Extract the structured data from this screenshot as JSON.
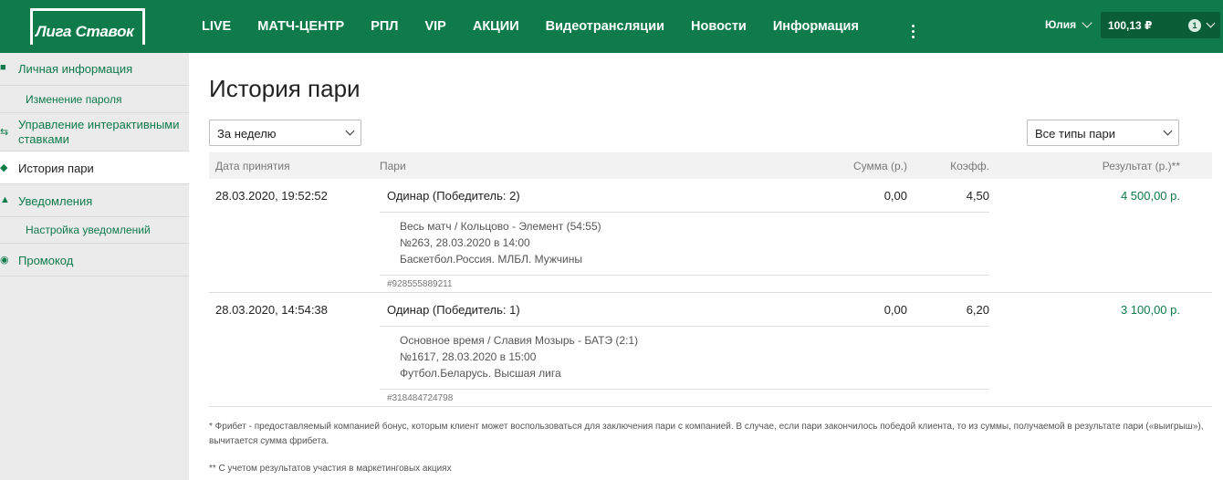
{
  "header": {
    "logo_text": "Лига Ставок",
    "nav": [
      "LIVE",
      "МАТЧ-ЦЕНТР",
      "РПЛ",
      "VIP",
      "АКЦИИ",
      "Видеотрансляции",
      "Новости",
      "Информация"
    ],
    "user_name": "Юлия",
    "balance": "100,13 ₽",
    "badge_count": "1"
  },
  "sidebar": {
    "items": [
      {
        "label": "Личная информация",
        "icon": "person-icon"
      },
      {
        "label": "Изменение пароля"
      },
      {
        "label": "Управление интерактивными ставками",
        "icon": "arrows-icon"
      },
      {
        "label": "История пари",
        "icon": "ticket-icon"
      },
      {
        "label": "Уведомления",
        "icon": "bell-icon"
      },
      {
        "label": "Настройка уведомлений"
      },
      {
        "label": "Промокод",
        "icon": "promo-icon"
      }
    ]
  },
  "main": {
    "title": "История пари",
    "period_filter": "За неделю",
    "type_filter": "Все типы пари",
    "columns": {
      "date": "Дата принятия",
      "bet": "Пари",
      "sum": "Сумма (р.)",
      "coef": "Коэфф.",
      "result": "Результат (р.)**"
    },
    "bets": [
      {
        "date": "28.03.2020, 19:52:52",
        "type": "Одинар (Победитель: 2)",
        "sum": "0,00",
        "coef": "4,50",
        "result": "4 500,00 р.",
        "line1": "Весь матч / Кольцово - Элемент (54:55)",
        "line2": "№263, 28.03.2020 в 14:00",
        "line3": "Баскетбол.Россия. МЛБЛ. Мужчины",
        "id": "#928555889211"
      },
      {
        "date": "28.03.2020, 14:54:38",
        "type": "Одинар (Победитель: 1)",
        "sum": "0,00",
        "coef": "6,20",
        "result": "3 100,00 р.",
        "line1": "Основное время / Славия Мозырь - БАТЭ (2:1)",
        "line2": "№1617, 28.03.2020 в 15:00",
        "line3": "Футбол.Беларусь. Высшая лига",
        "id": "#318484724798"
      }
    ],
    "footnote1": "* Фрибет - предоставляемый компанией бонус, которым клиент может воспользоваться для заключения пари с компанией. В случае, если пари закончилось победой клиента, то из суммы, получаемой в результате пари («выигрыш»), вычитается сумма фрибета.",
    "footnote2": "** С учетом результатов участия в маркетинговых акциях"
  },
  "colors": {
    "brand": "#0f7a4a"
  }
}
